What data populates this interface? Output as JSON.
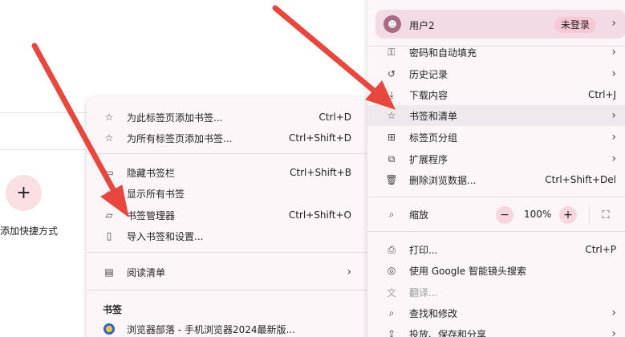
{
  "background": {
    "shortcut_plus": "+",
    "shortcut_label": "添加快捷方式"
  },
  "bookmarks_menu": {
    "items": [
      {
        "icon": "star-icon",
        "label": "为此标签页添加书签...",
        "shortcut": "Ctrl+D"
      },
      {
        "icon": "star-all-icon",
        "label": "为所有标签页添加书签...",
        "shortcut": "Ctrl+Shift+D"
      },
      {
        "icon": "bookmark-bar-icon",
        "label": "隐藏书签栏",
        "shortcut": "Ctrl+Shift+B"
      },
      {
        "icon": "star-icon",
        "label": "显示所有书签",
        "shortcut": ""
      },
      {
        "icon": "folder-icon",
        "label": "书签管理器",
        "shortcut": "Ctrl+Shift+O"
      },
      {
        "icon": "import-icon",
        "label": "导入书签和设置...",
        "shortcut": ""
      },
      {
        "icon": "reading-list-icon",
        "label": "阅读清单",
        "shortcut": ""
      }
    ],
    "section_title": "书签",
    "bookmark_item": "浏览器部落 - 手机浏览器2024最新版..."
  },
  "main_menu": {
    "profile": {
      "name": "用户2",
      "badge": "未登录"
    },
    "items": [
      {
        "icon": "key-icon",
        "label": "密码和自动填充",
        "shortcut": ""
      },
      {
        "icon": "history-icon",
        "label": "历史记录",
        "shortcut": ""
      },
      {
        "icon": "download-icon",
        "label": "下载内容",
        "shortcut": "Ctrl+J"
      },
      {
        "icon": "star-icon",
        "label": "书签和清单",
        "shortcut": ""
      },
      {
        "icon": "tab-groups-icon",
        "label": "标签页分组",
        "shortcut": ""
      },
      {
        "icon": "extension-icon",
        "label": "扩展程序",
        "shortcut": ""
      },
      {
        "icon": "trash-icon",
        "label": "删除浏览数据...",
        "shortcut": "Ctrl+Shift+Del"
      }
    ],
    "zoom": {
      "label": "缩放",
      "minus": "−",
      "value": "100%",
      "plus": "+"
    },
    "items2": [
      {
        "icon": "print-icon",
        "label": "打印...",
        "shortcut": "Ctrl+P"
      },
      {
        "icon": "lens-icon",
        "label": "使用 Google 智能镜头搜索",
        "shortcut": ""
      },
      {
        "icon": "translate-icon",
        "label": "翻译...",
        "shortcut": ""
      },
      {
        "icon": "find-icon",
        "label": "查找和修改",
        "shortcut": ""
      },
      {
        "icon": "share-icon",
        "label": "投放、保存和分享",
        "shortcut": ""
      }
    ]
  },
  "colors": {
    "arrow": "#e8473d",
    "menu_bg": "#fdf6f9",
    "highlight": "#efe8ec",
    "profile_bg": "#f2dbe4"
  }
}
